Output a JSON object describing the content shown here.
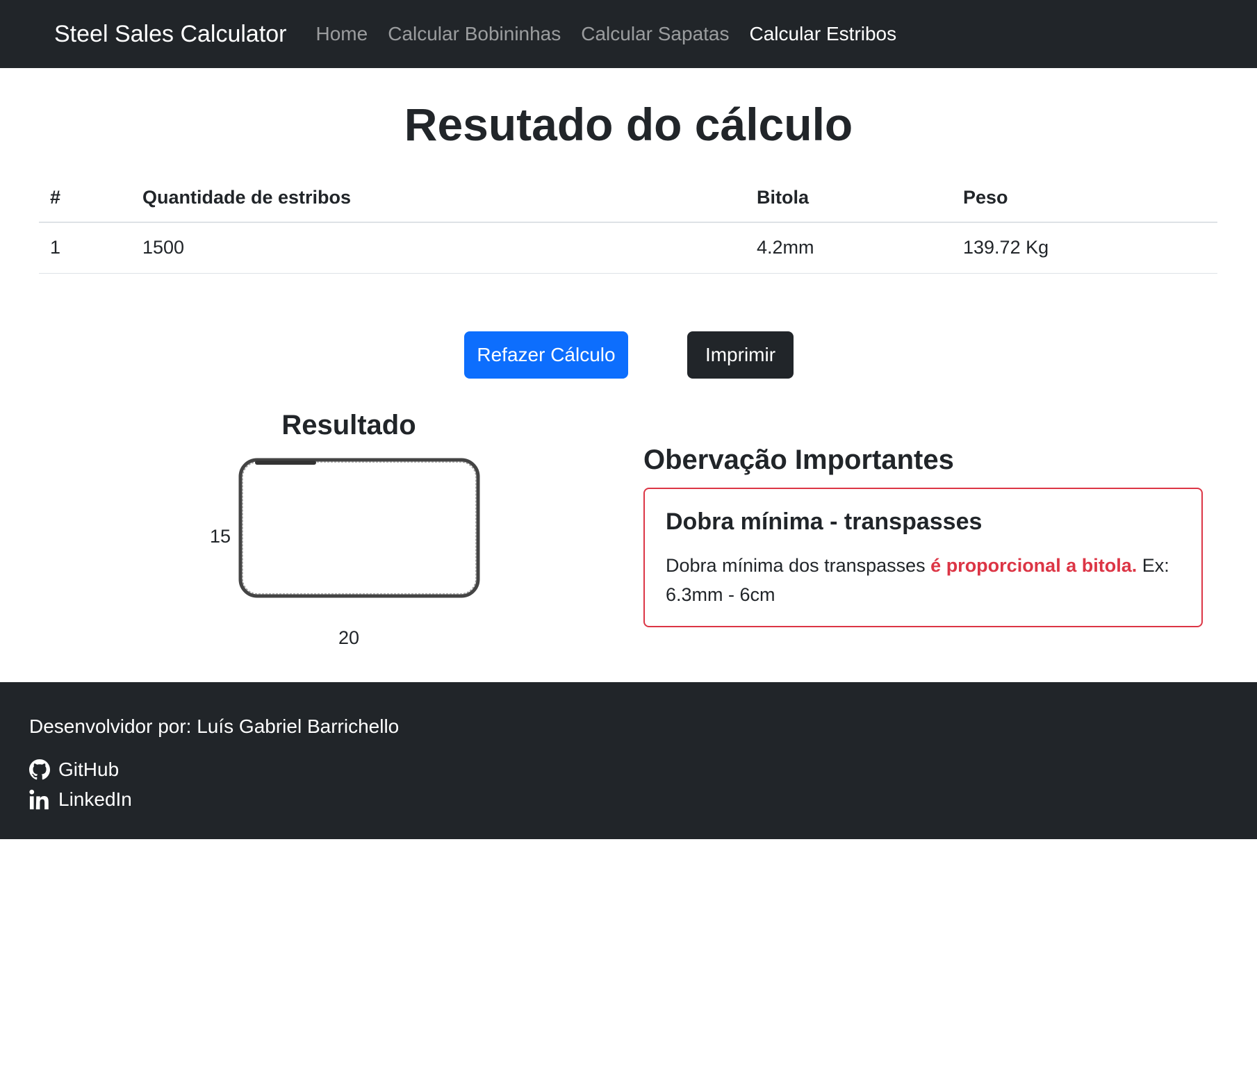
{
  "navbar": {
    "brand": "Steel Sales Calculator",
    "links": [
      "Home",
      "Calcular Bobininhas",
      "Calcular Sapatas",
      "Calcular Estribos"
    ],
    "active_index": 3
  },
  "main": {
    "title": "Resutado do cálculo",
    "table": {
      "headers": [
        "#",
        "Quantidade de estribos",
        "Bitola",
        "Peso"
      ],
      "rows": [
        [
          "1",
          "1500",
          "4.2mm",
          "139.72 Kg"
        ]
      ]
    },
    "buttons": {
      "redo": "Refazer Cálculo",
      "print": "Imprimir"
    },
    "result": {
      "heading": "Resultado",
      "height": "15",
      "width": "20"
    },
    "observations": {
      "heading": "Obervação Importantes",
      "card_title": "Dobra mínima - transpasses",
      "text_before": "Dobra mínima dos transpasses ",
      "text_highlight": "é proporcional a bitola.",
      "text_after": " Ex: 6.3mm - 6cm"
    }
  },
  "footer": {
    "developer": "Desenvolvidor por: Luís Gabriel Barrichello",
    "github": "GitHub",
    "linkedin": "LinkedIn"
  },
  "colors": {
    "navbar_bg": "#212529",
    "primary": "#0d6efd",
    "danger": "#dc3545"
  }
}
